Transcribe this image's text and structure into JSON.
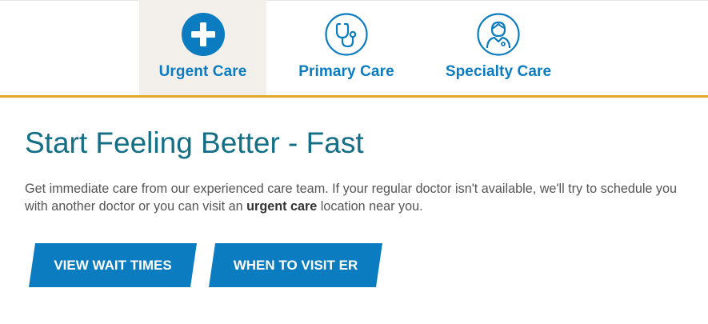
{
  "tabs": [
    {
      "label": "Urgent Care",
      "icon": "plus-circle-icon",
      "active": true
    },
    {
      "label": "Primary Care",
      "icon": "stethoscope-icon",
      "active": false
    },
    {
      "label": "Specialty Care",
      "icon": "doctor-icon",
      "active": false
    }
  ],
  "content": {
    "heading": "Start Feeling Better - Fast",
    "body_part1": "Get immediate care from our experienced care team. If your regular doctor isn't available, we'll try to schedule you with another doctor or you can visit an ",
    "body_bold": "urgent care",
    "body_part2": " location near you."
  },
  "buttons": {
    "wait_times": "VIEW WAIT TIMES",
    "visit_er": "WHEN TO VISIT ER"
  },
  "colors": {
    "primary_blue": "#0b7cc0",
    "heading_teal": "#146f86",
    "gold_accent": "#e1a829",
    "active_tab_bg": "#f3efea"
  }
}
